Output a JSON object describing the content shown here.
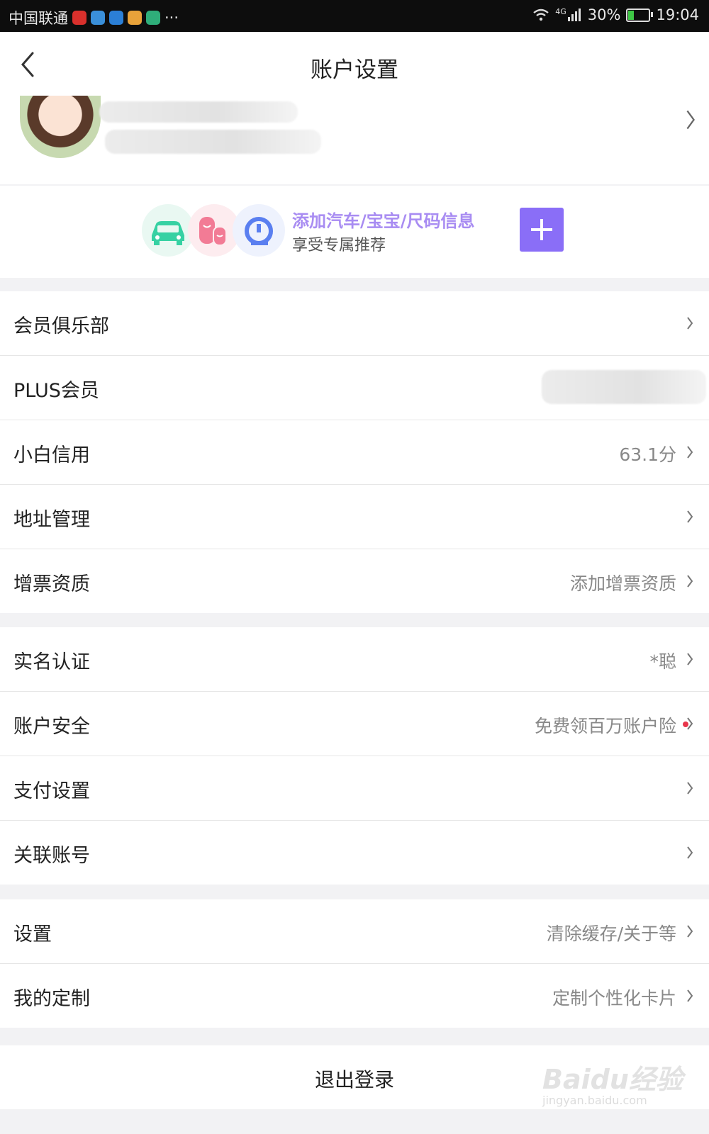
{
  "status_bar": {
    "carrier": "中国联通",
    "more": "···",
    "network": "4G",
    "battery_percent": "30%",
    "battery_level": 0.3,
    "time": "19:04"
  },
  "nav": {
    "title": "账户设置"
  },
  "banner": {
    "title": "添加汽车/宝宝/尺码信息",
    "subtitle": "享受专属推荐"
  },
  "groups": [
    {
      "rows": [
        {
          "label": "会员俱乐部",
          "value": ""
        },
        {
          "label": "PLUS会员",
          "value": ""
        },
        {
          "label": "小白信用",
          "value": "63.1分"
        },
        {
          "label": "地址管理",
          "value": ""
        },
        {
          "label": "增票资质",
          "value": "添加增票资质"
        }
      ]
    },
    {
      "rows": [
        {
          "label": "实名认证",
          "value": "*聪"
        },
        {
          "label": "账户安全",
          "value": "免费领百万账户险"
        },
        {
          "label": "支付设置",
          "value": ""
        },
        {
          "label": "关联账号",
          "value": ""
        }
      ]
    },
    {
      "rows": [
        {
          "label": "设置",
          "value": "清除缓存/关于等"
        },
        {
          "label": "我的定制",
          "value": "定制个性化卡片"
        }
      ]
    }
  ],
  "logout": {
    "label": "退出登录"
  },
  "watermark": {
    "brand": "Baidu经验",
    "url": "jingyan.baidu.com"
  },
  "colors": {
    "accent": "#8a6ef7",
    "banner_title": "#a88cf2",
    "alert_dot": "#e8364b"
  }
}
